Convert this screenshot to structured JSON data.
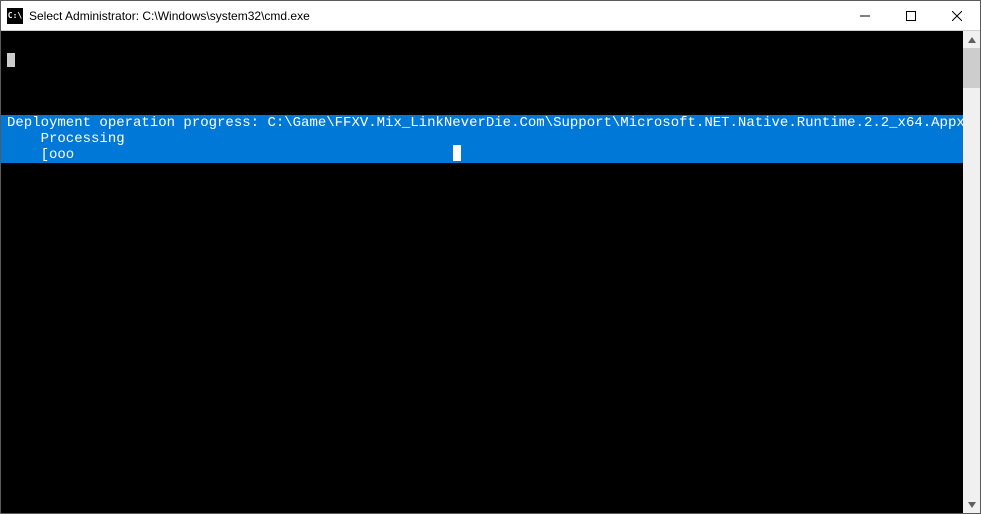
{
  "window": {
    "title": "Select Administrator: C:\\Windows\\system32\\cmd.exe"
  },
  "terminal": {
    "line1_text": "Deployment operation progress: C:\\Game\\FFXV.Mix_LinkNeverDie.Com\\Support\\Microsoft.NET.Native.Runtime.2.2_x64.Appx",
    "line2_text": "    Processing",
    "line3_text": "    [ooo                                                                                                                       ]"
  }
}
